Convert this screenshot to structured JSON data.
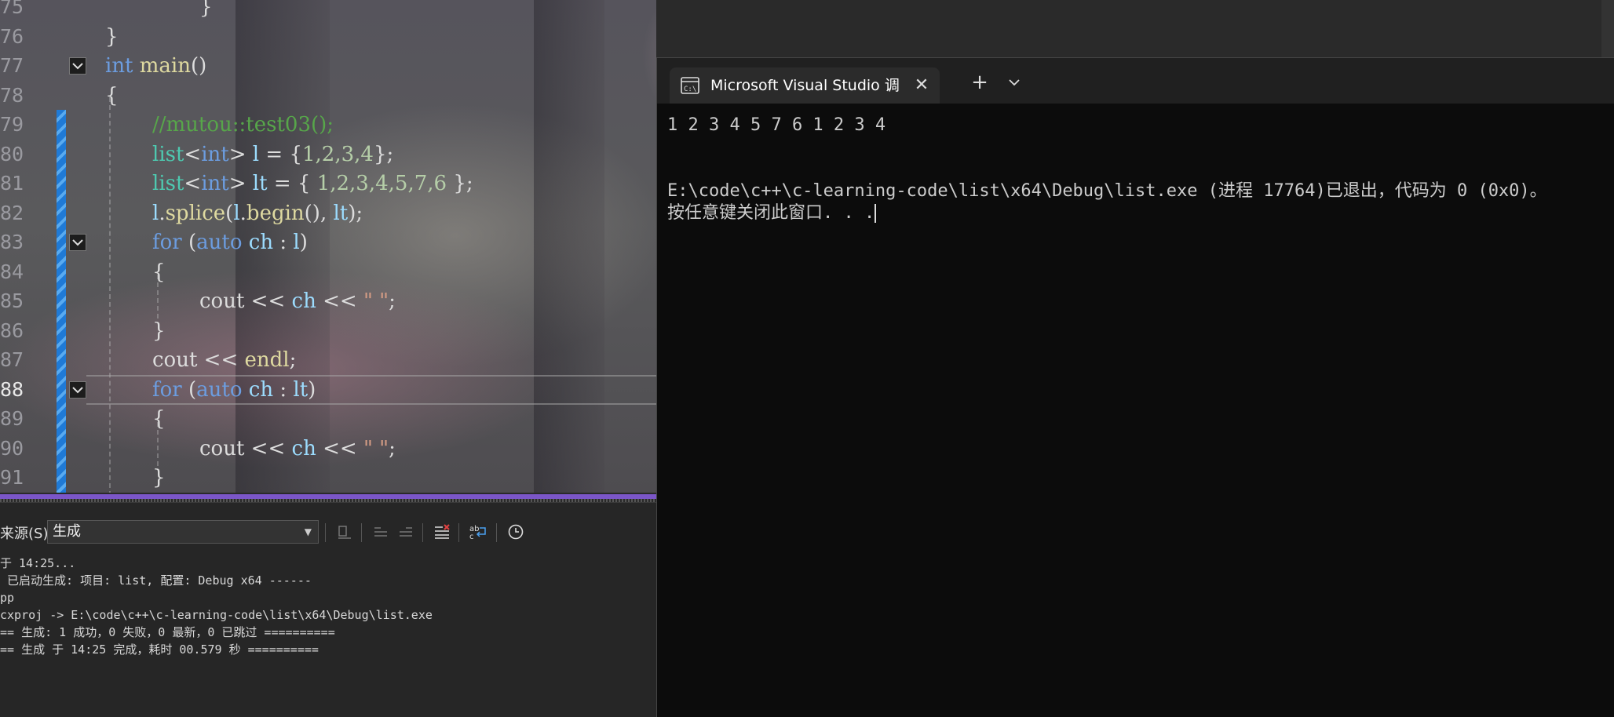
{
  "editor": {
    "lines": [
      {
        "num": "75",
        "code": [
          {
            "t": "}",
            "c": "op"
          }
        ],
        "indent": 2
      },
      {
        "num": "76",
        "code": [
          {
            "t": "}",
            "c": "op"
          }
        ],
        "indent": 0
      },
      {
        "num": "77",
        "code": [
          {
            "t": "int",
            "c": "kw"
          },
          {
            "t": " ",
            "c": "op"
          },
          {
            "t": "main",
            "c": "fn"
          },
          {
            "t": "()",
            "c": "op"
          }
        ],
        "indent": 0,
        "fold": true
      },
      {
        "num": "78",
        "code": [
          {
            "t": "{",
            "c": "op"
          }
        ],
        "indent": 0
      },
      {
        "num": "79",
        "code": [
          {
            "t": "//mutou::test03();",
            "c": "cm"
          }
        ],
        "indent": 1
      },
      {
        "num": "80",
        "code": [
          {
            "t": "list",
            "c": "ty"
          },
          {
            "t": "<",
            "c": "op"
          },
          {
            "t": "int",
            "c": "kw"
          },
          {
            "t": "> ",
            "c": "op"
          },
          {
            "t": "l",
            "c": "var"
          },
          {
            "t": " = {",
            "c": "op"
          },
          {
            "t": "1,2,3,4",
            "c": "num"
          },
          {
            "t": "};",
            "c": "op"
          }
        ],
        "indent": 1
      },
      {
        "num": "81",
        "code": [
          {
            "t": "list",
            "c": "ty"
          },
          {
            "t": "<",
            "c": "op"
          },
          {
            "t": "int",
            "c": "kw"
          },
          {
            "t": "> ",
            "c": "op"
          },
          {
            "t": "lt",
            "c": "var"
          },
          {
            "t": " = { ",
            "c": "op"
          },
          {
            "t": "1,2,3,4,5,7,6",
            "c": "num"
          },
          {
            "t": " };",
            "c": "op"
          }
        ],
        "indent": 1
      },
      {
        "num": "82",
        "code": [
          {
            "t": "l",
            "c": "var"
          },
          {
            "t": ".",
            "c": "op"
          },
          {
            "t": "splice",
            "c": "fn"
          },
          {
            "t": "(",
            "c": "op"
          },
          {
            "t": "l",
            "c": "var"
          },
          {
            "t": ".",
            "c": "op"
          },
          {
            "t": "begin",
            "c": "fn"
          },
          {
            "t": "(), ",
            "c": "op"
          },
          {
            "t": "lt",
            "c": "var"
          },
          {
            "t": ");",
            "c": "op"
          }
        ],
        "indent": 1
      },
      {
        "num": "83",
        "code": [
          {
            "t": "for",
            "c": "kw"
          },
          {
            "t": " (",
            "c": "op"
          },
          {
            "t": "auto",
            "c": "kw"
          },
          {
            "t": " ",
            "c": "op"
          },
          {
            "t": "ch",
            "c": "var"
          },
          {
            "t": " : ",
            "c": "op"
          },
          {
            "t": "l",
            "c": "var"
          },
          {
            "t": ")",
            "c": "op"
          }
        ],
        "indent": 1,
        "fold": true
      },
      {
        "num": "84",
        "code": [
          {
            "t": "{",
            "c": "op"
          }
        ],
        "indent": 1
      },
      {
        "num": "85",
        "code": [
          {
            "t": "cout",
            "c": "op"
          },
          {
            "t": " << ",
            "c": "op"
          },
          {
            "t": "ch",
            "c": "var"
          },
          {
            "t": " << ",
            "c": "op"
          },
          {
            "t": "\" \"",
            "c": "str"
          },
          {
            "t": ";",
            "c": "op"
          }
        ],
        "indent": 2
      },
      {
        "num": "86",
        "code": [
          {
            "t": "}",
            "c": "op"
          }
        ],
        "indent": 1
      },
      {
        "num": "87",
        "code": [
          {
            "t": "cout",
            "c": "op"
          },
          {
            "t": " << ",
            "c": "op"
          },
          {
            "t": "endl",
            "c": "fn"
          },
          {
            "t": ";",
            "c": "op"
          }
        ],
        "indent": 1
      },
      {
        "num": "88",
        "code": [
          {
            "t": "for",
            "c": "kw"
          },
          {
            "t": " (",
            "c": "op"
          },
          {
            "t": "auto",
            "c": "kw"
          },
          {
            "t": " ",
            "c": "op"
          },
          {
            "t": "ch",
            "c": "var"
          },
          {
            "t": " : ",
            "c": "op"
          },
          {
            "t": "lt",
            "c": "var"
          },
          {
            "t": ")",
            "c": "op"
          }
        ],
        "indent": 1,
        "fold": true,
        "active": true
      },
      {
        "num": "89",
        "code": [
          {
            "t": "{",
            "c": "op"
          }
        ],
        "indent": 1
      },
      {
        "num": "90",
        "code": [
          {
            "t": "cout",
            "c": "op"
          },
          {
            "t": " << ",
            "c": "op"
          },
          {
            "t": "ch",
            "c": "var"
          },
          {
            "t": " << ",
            "c": "op"
          },
          {
            "t": "\" \"",
            "c": "str"
          },
          {
            "t": ";",
            "c": "op"
          }
        ],
        "indent": 2
      },
      {
        "num": "91",
        "code": [
          {
            "t": "}",
            "c": "op"
          }
        ],
        "indent": 1
      }
    ]
  },
  "output_panel": {
    "source_label": "来源(S):",
    "source_value": "生成",
    "lines": [
      "于 14:25...",
      " 已启动生成: 项目: list, 配置: Debug x64 ------",
      "pp",
      "cxproj -> E:\\code\\c++\\c-learning-code\\list\\x64\\Debug\\list.exe",
      "== 生成: 1 成功，0 失败，0 最新，0 已跳过 ==========",
      "== 生成 于 14:25 完成，耗时 00.579 秒 =========="
    ]
  },
  "terminal": {
    "tab_title": "Microsoft Visual Studio 调试控制台",
    "lines": [
      "1 2 3 4 5 7 6 1 2 3 4",
      "",
      "",
      "E:\\code\\c++\\c-learning-code\\list\\x64\\Debug\\list.exe (进程 17764)已退出，代码为 0 (0x0)。",
      "按任意键关闭此窗口. . ."
    ]
  },
  "colors": {
    "change_bar": "#1f7ad6",
    "splitter": "#7b56c8",
    "terminal_bg": "#0c0c0c"
  }
}
